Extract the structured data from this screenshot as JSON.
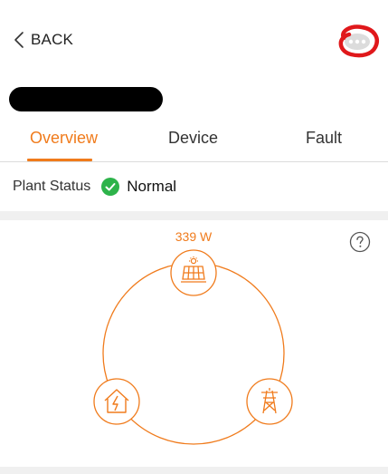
{
  "header": {
    "back_label": "BACK",
    "more_icon": "more-dots-icon"
  },
  "tabs": [
    {
      "label": "Overview",
      "active": true
    },
    {
      "label": "Device",
      "active": false
    },
    {
      "label": "Fault",
      "active": false
    }
  ],
  "plant_status": {
    "label": "Plant Status",
    "value": "Normal",
    "status_color": "#2db34a"
  },
  "energy_flow": {
    "solar_power": "339 W",
    "nodes": [
      {
        "name": "solar-panel-icon"
      },
      {
        "name": "home-icon"
      },
      {
        "name": "grid-tower-icon"
      }
    ]
  },
  "colors": {
    "accent": "#f07b1c",
    "annotation": "#e0181b",
    "divider": "#dcdcdc"
  }
}
